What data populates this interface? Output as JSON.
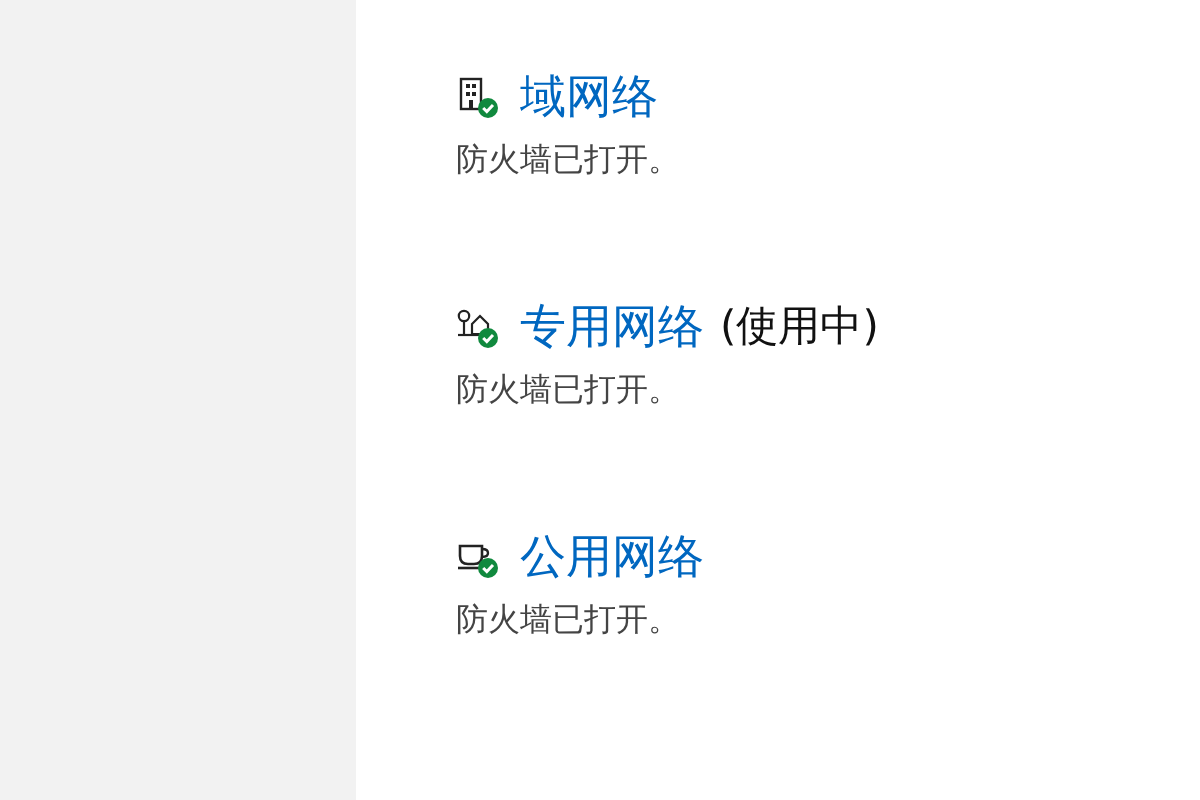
{
  "networks": [
    {
      "kind": "domain",
      "name": "域网络",
      "firewall_on": true,
      "status": "防火墙已打开。"
    },
    {
      "kind": "private",
      "name": "专用网络",
      "in_use": "(使用中)",
      "firewall_on": true,
      "status": "防火墙已打开。"
    },
    {
      "kind": "public",
      "name": "公用网络",
      "firewall_on": true,
      "status": "防火墙已打开。"
    }
  ]
}
